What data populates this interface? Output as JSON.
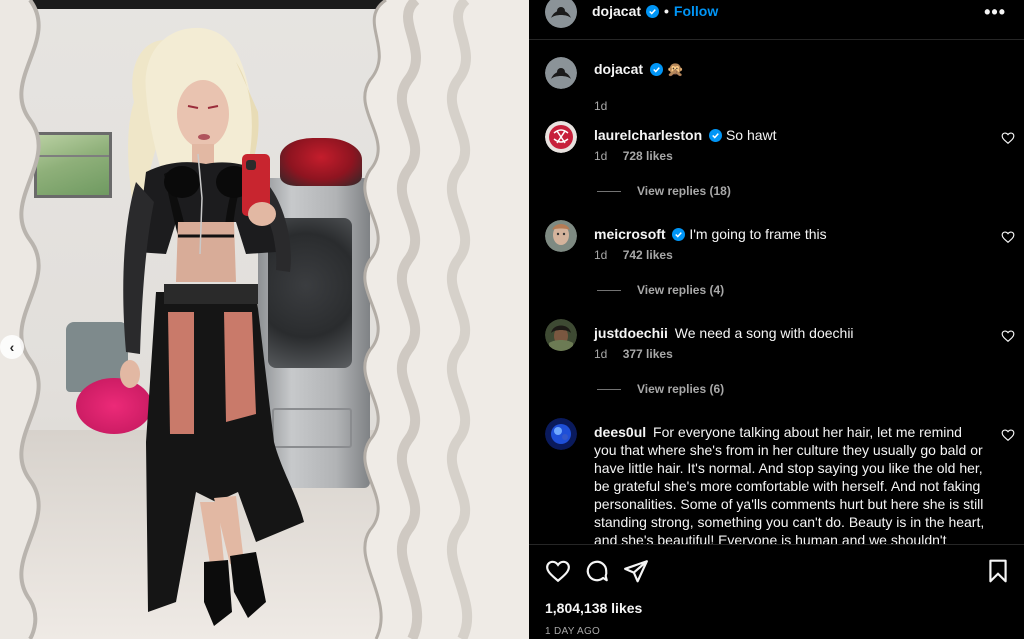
{
  "post": {
    "author": "dojacat",
    "follow_label": "Follow",
    "separator": "•",
    "more_label": "•••",
    "caption": {
      "username": "dojacat",
      "emoji": "🙊",
      "time": "1d"
    }
  },
  "comments": [
    {
      "username": "laurelcharleston",
      "verified": true,
      "text": "So hawt",
      "time": "1d",
      "likes": "728 likes",
      "replies": "View replies (18)"
    },
    {
      "username": "meicrosoft",
      "verified": true,
      "text": "I'm going to frame this",
      "time": "1d",
      "likes": "742 likes",
      "replies": "View replies (4)"
    },
    {
      "username": "justdoechii",
      "verified": false,
      "text": "We need a song with doechii",
      "time": "1d",
      "likes": "377 likes",
      "replies": "View replies (6)"
    },
    {
      "username": "dees0ul",
      "verified": false,
      "text": "For everyone talking about her hair, let me remind you that where she's from in her culture they usually go bald or have little hair. It's normal. And stop saying you like the old her, be grateful she's more comfortable with herself. And not faking personalities. Some of ya'lls comments hurt but here she is still standing strong, something you can't do. Beauty is in the heart, and she's beautiful! Everyone is human and we shouldn't"
    }
  ],
  "footer": {
    "likes_total": "1,804,138 likes",
    "time_ago": "1 DAY AGO"
  },
  "icons": {
    "like": "heart-icon",
    "comment": "comment-icon",
    "share": "share-icon",
    "save": "bookmark-icon",
    "carousel_prev": "chevron-left-icon"
  },
  "colors": {
    "accent": "#0095f6",
    "background": "#000000",
    "muted": "#a8a8a8"
  }
}
